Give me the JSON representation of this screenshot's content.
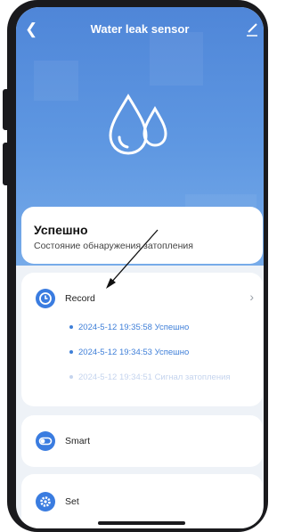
{
  "header": {
    "back_icon": "chevron-left-icon",
    "title": "Water leak sensor",
    "edit_icon": "pencil-icon"
  },
  "hero": {
    "icon": "water-drops-icon"
  },
  "status": {
    "title": "Успешно",
    "subtitle": "Состояние обнаружения затопления"
  },
  "record": {
    "label": "Record",
    "icon": "clock-icon",
    "entries": [
      {
        "text": "2024-5-12 19:35:58 Успешно"
      },
      {
        "text": "2024-5-12 19:34:53 Успешно"
      },
      {
        "text": "2024-5-12 19:34:51 Сигнал затопления"
      }
    ]
  },
  "smart": {
    "label": "Smart",
    "icon": "toggle-icon"
  },
  "set": {
    "label": "Set",
    "icon": "gear-icon"
  },
  "colors": {
    "accent": "#3a7ce0",
    "hero": "#5f98e2"
  }
}
